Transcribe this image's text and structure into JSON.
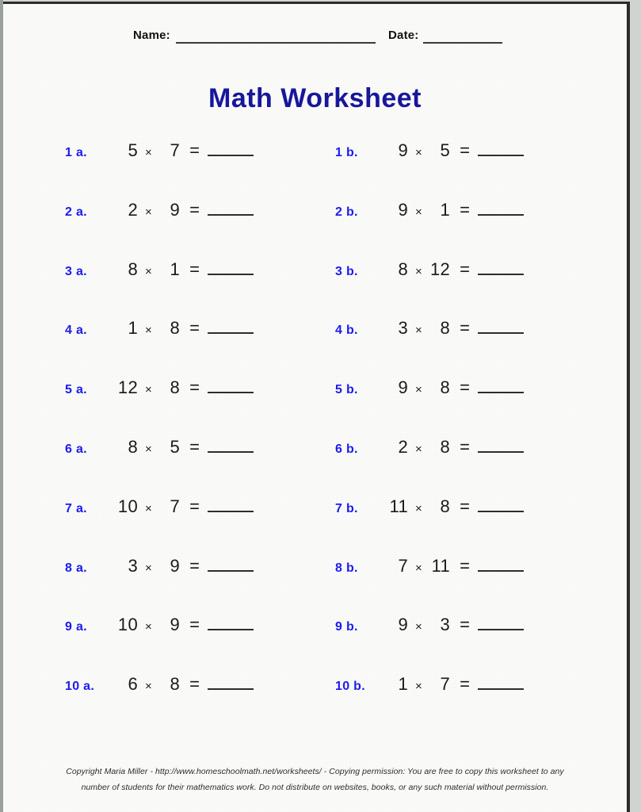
{
  "page": {
    "title": "Math Worksheet",
    "title_color": "#17179c",
    "label_color": "#1b1bf0",
    "paper_color": "#fbfbf9"
  },
  "header": {
    "name_label": "Name:",
    "name_value": "",
    "date_label": "Date:",
    "date_value": ""
  },
  "problems": {
    "times_symbol": "×",
    "equals_symbol": "=",
    "rows": [
      {
        "a": {
          "label": "1 a.",
          "left": "5",
          "right": "7",
          "answer": ""
        },
        "b": {
          "label": "1 b.",
          "left": "9",
          "right": "5",
          "answer": ""
        }
      },
      {
        "a": {
          "label": "2 a.",
          "left": "2",
          "right": "9",
          "answer": ""
        },
        "b": {
          "label": "2 b.",
          "left": "9",
          "right": "1",
          "answer": ""
        }
      },
      {
        "a": {
          "label": "3 a.",
          "left": "8",
          "right": "1",
          "answer": ""
        },
        "b": {
          "label": "3 b.",
          "left": "8",
          "right": "12",
          "answer": ""
        }
      },
      {
        "a": {
          "label": "4 a.",
          "left": "1",
          "right": "8",
          "answer": ""
        },
        "b": {
          "label": "4 b.",
          "left": "3",
          "right": "8",
          "answer": ""
        }
      },
      {
        "a": {
          "label": "5 a.",
          "left": "12",
          "right": "8",
          "answer": ""
        },
        "b": {
          "label": "5 b.",
          "left": "9",
          "right": "8",
          "answer": ""
        }
      },
      {
        "a": {
          "label": "6 a.",
          "left": "8",
          "right": "5",
          "answer": ""
        },
        "b": {
          "label": "6 b.",
          "left": "2",
          "right": "8",
          "answer": ""
        }
      },
      {
        "a": {
          "label": "7 a.",
          "left": "10",
          "right": "7",
          "answer": ""
        },
        "b": {
          "label": "7 b.",
          "left": "11",
          "right": "8",
          "answer": ""
        }
      },
      {
        "a": {
          "label": "8 a.",
          "left": "3",
          "right": "9",
          "answer": ""
        },
        "b": {
          "label": "8 b.",
          "left": "7",
          "right": "11",
          "answer": ""
        }
      },
      {
        "a": {
          "label": "9 a.",
          "left": "10",
          "right": "9",
          "answer": ""
        },
        "b": {
          "label": "9 b.",
          "left": "9",
          "right": "3",
          "answer": ""
        }
      },
      {
        "a": {
          "label": "10 a.",
          "left": "6",
          "right": "8",
          "answer": ""
        },
        "b": {
          "label": "10 b.",
          "left": "1",
          "right": "7",
          "answer": ""
        }
      }
    ]
  },
  "footer": {
    "line1": "Copyright Maria Miller - http://www.homeschoolmath.net/worksheets/ - Copying permission: You are free to copy this worksheet to any",
    "line2": "number of students for their mathematics work. Do not distribute on websites, books, or any such material without permission."
  }
}
